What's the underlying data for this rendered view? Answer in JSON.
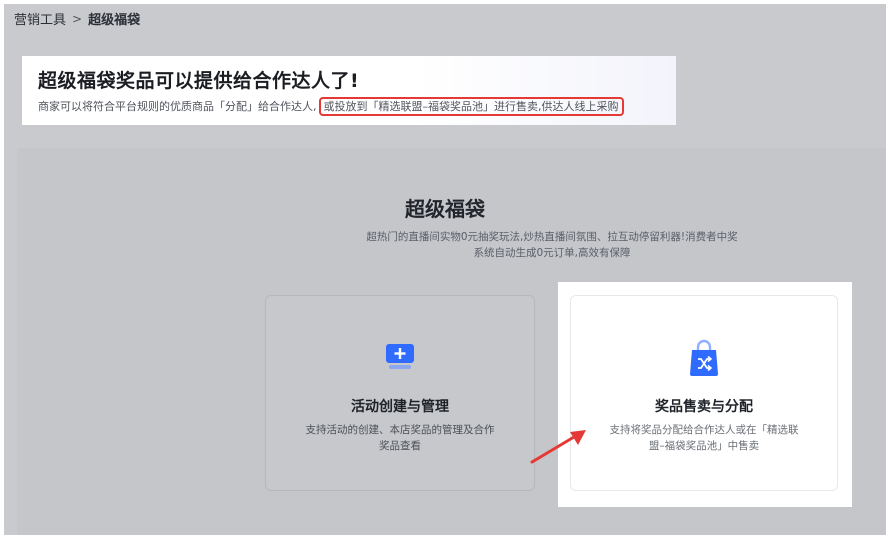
{
  "breadcrumb": {
    "parent": "营销工具",
    "separator": ">",
    "current": "超级福袋"
  },
  "banner": {
    "title": "超级福袋奖品可以提供给合作达人了!",
    "desc_plain": "商家可以将符合平台规则的优质商品「分配」给合作达人,",
    "desc_highlight": "或投放到「精选联盟–福袋奖品池」进行售卖,供达人线上采购"
  },
  "product": {
    "title": "超级福袋",
    "desc_line1": "超热门的直播间实物0元抽奖玩法,炒热直播间氛围、拉互动停留利器!消费者中奖",
    "desc_line2": "系统自动生成0元订单,高效有保障"
  },
  "cards": [
    {
      "icon": "monitor-plus-icon",
      "title": "活动创建与管理",
      "desc_line1": "支持活动的创建、本店奖品的管理及合作",
      "desc_line2": "奖品查看"
    },
    {
      "icon": "shopping-bag-shuffle-icon",
      "title": "奖品售卖与分配",
      "desc_line1": "支持将奖品分配给合作达人或在「精选联",
      "desc_line2": "盟–福袋奖品池」中售卖"
    }
  ],
  "colors": {
    "accent_blue": "#2f6bff",
    "highlight_red": "#e53935"
  }
}
